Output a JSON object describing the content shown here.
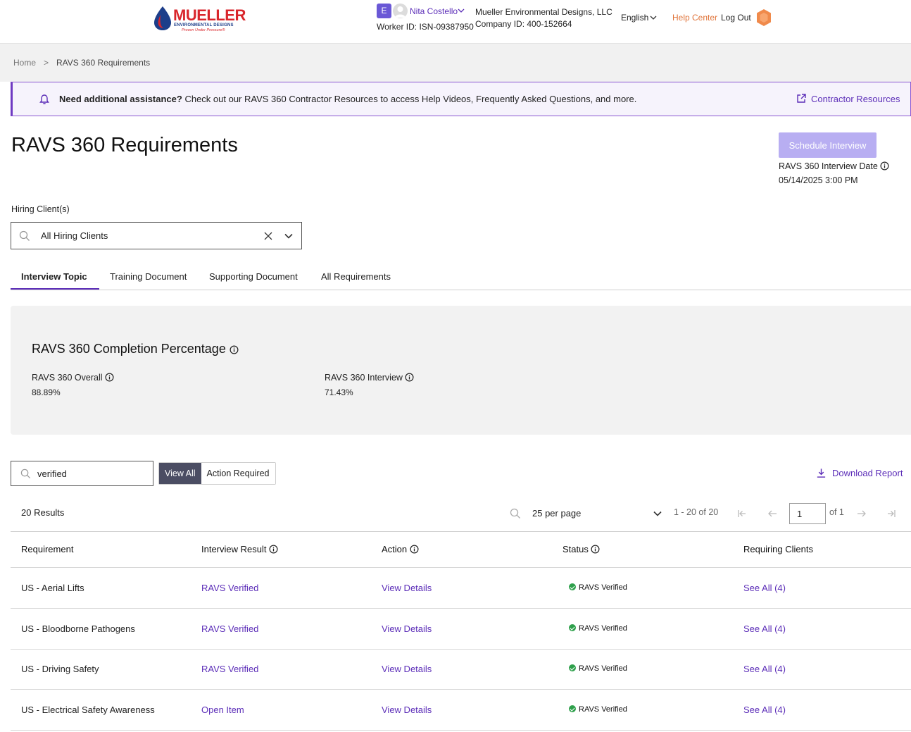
{
  "header": {
    "logo": {
      "title": "MUELLER",
      "subtitle": "ENVIRONMENTAL DESIGNS",
      "tagline": "Proven Under Pressure®"
    },
    "user": {
      "initial": "E",
      "name": "Nita Costello",
      "worker_id": "Worker ID: ISN-09387950"
    },
    "company": {
      "name": "Mueller Environmental Designs, LLC",
      "id": "Company ID: 400-152664"
    },
    "language": "English",
    "help_center": "Help Center",
    "logout": "Log Out"
  },
  "breadcrumb": {
    "home": "Home",
    "separator": ">",
    "current": "RAVS 360 Requirements"
  },
  "banner": {
    "bold": "Need additional assistance?",
    "text": " Check out our RAVS 360 Contractor Resources to access Help Videos, Frequently Asked Questions, and more.",
    "link": "Contractor Resources"
  },
  "page": {
    "title": "RAVS 360 Requirements",
    "schedule_button": "Schedule Interview",
    "interview_date_label": "RAVS 360 Interview Date",
    "interview_date_value": "05/14/2025 3:00 PM"
  },
  "hiring_client": {
    "label": "Hiring Client(s)",
    "value": "All Hiring Clients"
  },
  "tabs": [
    {
      "label": "Interview Topic",
      "active": true
    },
    {
      "label": "Training Document",
      "active": false
    },
    {
      "label": "Supporting Document",
      "active": false
    },
    {
      "label": "All Requirements",
      "active": false
    }
  ],
  "completion": {
    "title": "RAVS 360 Completion Percentage",
    "overall_label": "RAVS 360 Overall",
    "overall_value": "88.89%",
    "interview_label": "RAVS 360 Interview",
    "interview_value": "71.43%"
  },
  "filters": {
    "search_value": "verified",
    "view_all": "View All",
    "action_required": "Action Required",
    "download": "Download Report"
  },
  "pagination": {
    "results": "20 Results",
    "per_page": "25 per page",
    "range": "1 - 20 of 20",
    "page": "1",
    "of": "of 1"
  },
  "table": {
    "headers": {
      "requirement": "Requirement",
      "interview_result": "Interview Result",
      "action": "Action",
      "status": "Status",
      "requiring_clients": "Requiring Clients"
    },
    "rows": [
      {
        "requirement": "US - Aerial Lifts",
        "result": "RAVS Verified",
        "action": "View Details",
        "status": "RAVS Verified",
        "clients": "See All (4)"
      },
      {
        "requirement": "US - Bloodborne Pathogens",
        "result": "RAVS Verified",
        "action": "View Details",
        "status": "RAVS Verified",
        "clients": "See All (4)"
      },
      {
        "requirement": "US - Driving Safety",
        "result": "RAVS Verified",
        "action": "View Details",
        "status": "RAVS Verified",
        "clients": "See All (4)"
      },
      {
        "requirement": "US - Electrical Safety Awareness",
        "result": "Open Item",
        "action": "View Details",
        "status": "RAVS Verified",
        "clients": "See All (4)"
      }
    ]
  }
}
